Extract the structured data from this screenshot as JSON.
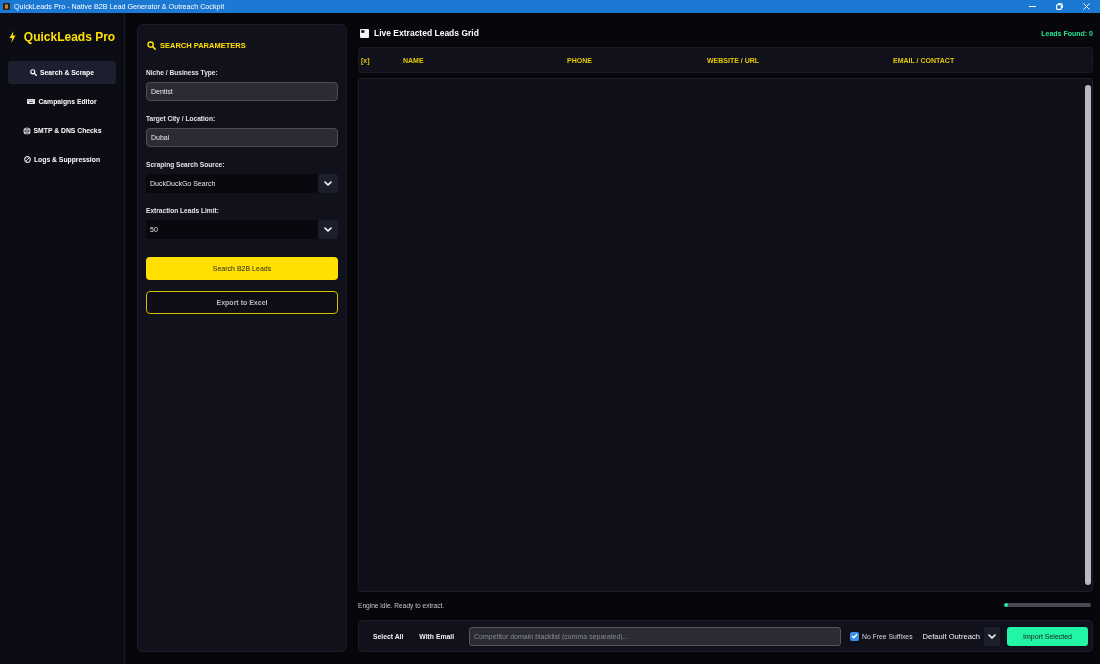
{
  "window": {
    "title": "QuickLeads Pro - Native B2B Lead Generator & Outreach Cockpit"
  },
  "sidebar": {
    "brand": "QuickLeads Pro",
    "items": [
      {
        "label": "Search & Scrape",
        "selected": true
      },
      {
        "label": "Campaigns Editor",
        "selected": false
      },
      {
        "label": "SMTP & DNS Checks",
        "selected": false
      },
      {
        "label": "Logs & Suppression",
        "selected": false
      }
    ]
  },
  "search_panel": {
    "title": "SEARCH PARAMETERS",
    "fields": [
      {
        "kind": "text",
        "label": "Niche / Business Type:",
        "value": "Dentist"
      },
      {
        "kind": "text",
        "label": "Target City / Location:",
        "value": "Dubai"
      },
      {
        "kind": "select",
        "label": "Scraping Search Source:",
        "value": "DuckDuckGo Search"
      },
      {
        "kind": "select",
        "label": "Extraction Leads Limit:",
        "value": "50"
      }
    ],
    "buttons": [
      {
        "kind": "primary",
        "label": "Search B2B Leads"
      },
      {
        "kind": "outline",
        "label": "Export to Excel"
      }
    ]
  },
  "grid": {
    "title": "Live Extracted Leads Grid",
    "count": "Leads Found: 0",
    "columns": [
      "[x]",
      "NAME",
      "PHONE",
      "WEBSITE / URL",
      "EMAIL / CONTACT"
    ]
  },
  "status": {
    "text": "Engine idle. Ready to extract.",
    "level": 0.05
  },
  "action_bar": {
    "buttons": [
      "Select All",
      "With Email"
    ],
    "blacklist": {
      "placeholder": "Competitor domain blacklist (comma separated)..."
    },
    "no_free_suffixes": {
      "label": "No Free Suffixes",
      "checked": true
    },
    "template": {
      "value": "Default Outreach"
    },
    "import_button": "Import Selected"
  }
}
